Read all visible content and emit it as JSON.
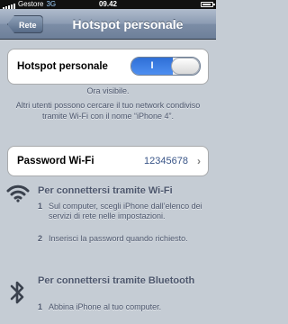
{
  "status_bar": {
    "carrier": "Gestore",
    "network": "3G",
    "time": "09.42",
    "battery_level": 0.85
  },
  "nav": {
    "back_label": "Rete",
    "title": "Hotspot personale"
  },
  "hotspot": {
    "label": "Hotspot personale",
    "toggle_label": "I",
    "toggle_state": "on"
  },
  "info": {
    "visibility": "Ora visibile.",
    "description": "Altri utenti possono cercare il tuo network condiviso tramite Wi-Fi con il nome “iPhone 4”."
  },
  "password": {
    "label": "Password Wi-Fi",
    "value": "12345678"
  },
  "wifi_section": {
    "icon": "wifi-icon",
    "title": "Per connettersi tramite Wi-Fi",
    "steps": [
      {
        "num": "1",
        "text": "Sul computer, scegli iPhone dall’elenco dei servizi di rete nelle impostazioni."
      },
      {
        "num": "2",
        "text": "Inserisci la password quando richiesto."
      }
    ]
  },
  "bluetooth_section": {
    "icon": "bluetooth-icon",
    "title": "Per connettersi tramite Bluetooth",
    "steps": [
      {
        "num": "1",
        "text": "Abbina iPhone al tuo computer."
      }
    ]
  }
}
